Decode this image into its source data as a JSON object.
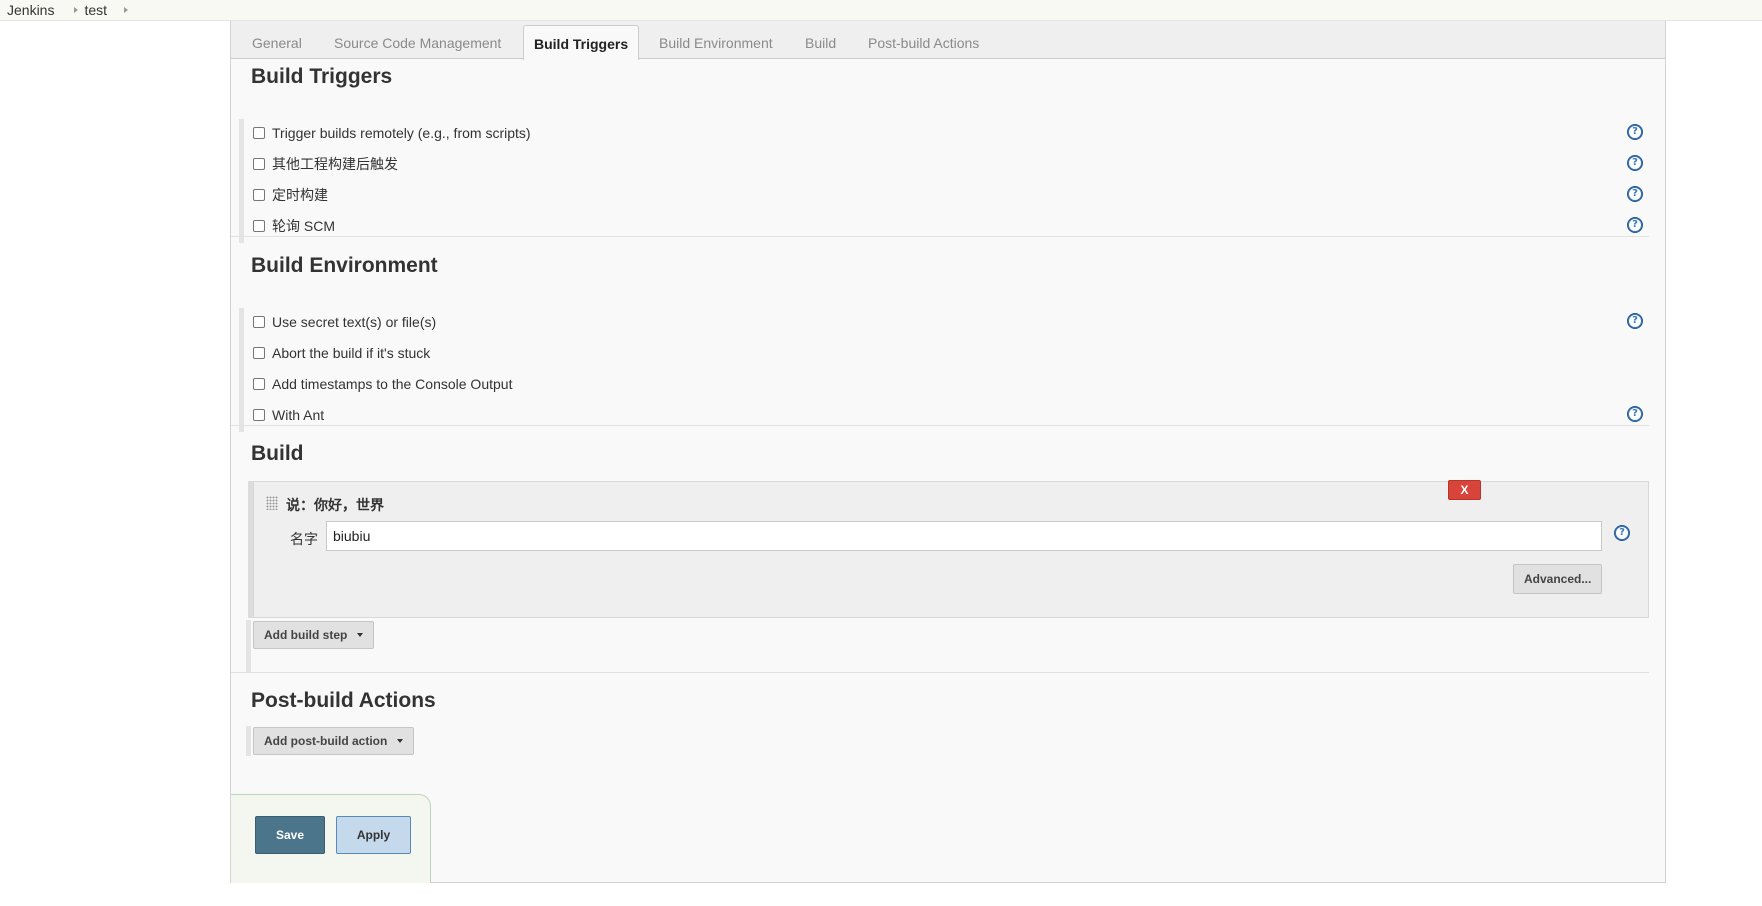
{
  "breadcrumb": {
    "items": [
      "Jenkins",
      "test"
    ]
  },
  "tabs": [
    {
      "label": "General",
      "active": false
    },
    {
      "label": "Source Code Management",
      "active": false
    },
    {
      "label": "Build Triggers",
      "active": true
    },
    {
      "label": "Build Environment",
      "active": false
    },
    {
      "label": "Build",
      "active": false
    },
    {
      "label": "Post-build Actions",
      "active": false
    }
  ],
  "build_triggers": {
    "title": "Build Triggers",
    "options": [
      {
        "label": "Trigger builds remotely (e.g., from scripts)",
        "checked": false
      },
      {
        "label": "其他工程构建后触发",
        "checked": false
      },
      {
        "label": "定时构建",
        "checked": false
      },
      {
        "label": "轮询 SCM",
        "checked": false
      }
    ]
  },
  "build_environment": {
    "title": "Build Environment",
    "options": [
      {
        "label": "Use secret text(s) or file(s)",
        "checked": false
      },
      {
        "label": "Abort the build if it's stuck",
        "checked": false
      },
      {
        "label": "Add timestamps to the Console Output",
        "checked": false
      },
      {
        "label": "With Ant",
        "checked": false
      }
    ]
  },
  "build": {
    "title": "Build",
    "step": {
      "title": "说：你好，世界",
      "delete_label": "X",
      "name_label": "名字",
      "name_value": "biubiu",
      "advanced_label": "Advanced..."
    },
    "add_step_label": "Add build step"
  },
  "post_build": {
    "title": "Post-build Actions",
    "add_action_label": "Add post-build action"
  },
  "actions": {
    "save_label": "Save",
    "apply_label": "Apply"
  },
  "icons": {
    "help": "help-icon",
    "drag": "drag-handle-icon",
    "caret": "caret-down-icon",
    "breadcrumb_arrow": "chevron-right-icon"
  },
  "colors": {
    "save_bg": "#4b758b",
    "apply_bg": "#c5d9ec",
    "delete_bg": "#d9443a",
    "help_icon": "#3a77b8"
  }
}
